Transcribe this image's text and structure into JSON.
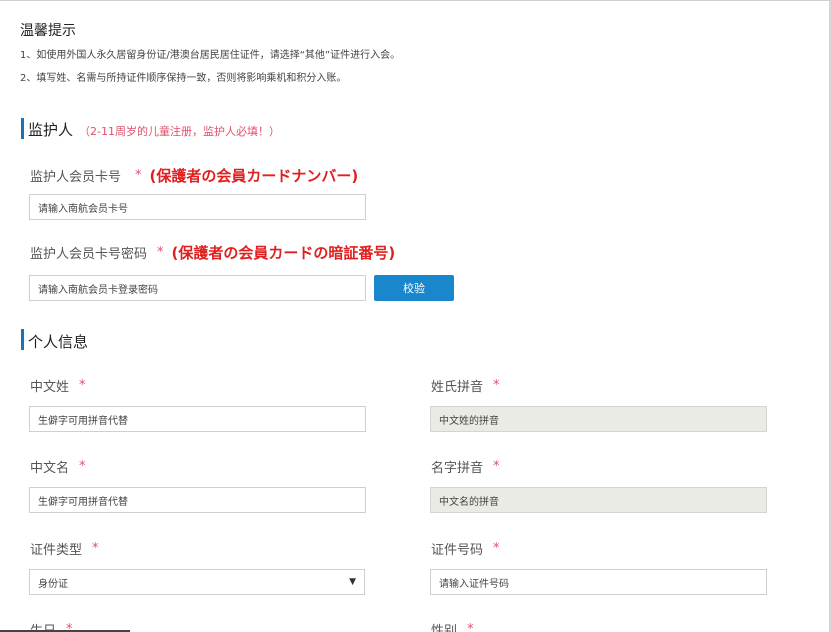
{
  "tips": {
    "title": "温馨提示",
    "lines": [
      "1、如使用外国人永久居留身份证/港澳台居民居住证件，请选择“其他”证件进行入会。",
      "2、填写姓、名需与所持证件顺序保持一致，否则将影响乘机和积分入账。"
    ]
  },
  "guardian": {
    "title": "监护人",
    "note": "（2-11周岁的儿童注册，监护人必填！）",
    "card_label": "监护人会员卡号",
    "card_required": "*",
    "card_jp_note": "(保護者の会員カードナンバー)",
    "card_placeholder": "请输入南航会员卡号",
    "pwd_label": "监护人会员卡号密码",
    "pwd_required": "*",
    "pwd_jp_note": "(保護者の会員カードの暗証番号)",
    "pwd_placeholder": "请输入南航会员卡登录密码",
    "verify_button": "校验"
  },
  "personal": {
    "title": "个人信息",
    "surname_label": "中文姓",
    "surname_placeholder": "生僻字可用拼音代替",
    "surname_pinyin_label": "姓氏拼音",
    "surname_pinyin_placeholder": "中文姓的拼音",
    "given_label": "中文名",
    "given_placeholder": "生僻字可用拼音代替",
    "given_pinyin_label": "名字拼音",
    "given_pinyin_placeholder": "中文名的拼音",
    "id_type_label": "证件类型",
    "id_type_value": "身份证",
    "id_no_label": "证件号码",
    "id_no_placeholder": "请输入证件号码",
    "birthday_label": "生日",
    "gender_label": "性别",
    "required": "*"
  },
  "icons": {
    "dropdown": "chevron-down-icon",
    "dropdown_glyph": "▼"
  },
  "colors": {
    "accent": "#1a73b8",
    "button": "#1a86cc",
    "required": "#e0506b",
    "jp_note": "#e02020"
  }
}
